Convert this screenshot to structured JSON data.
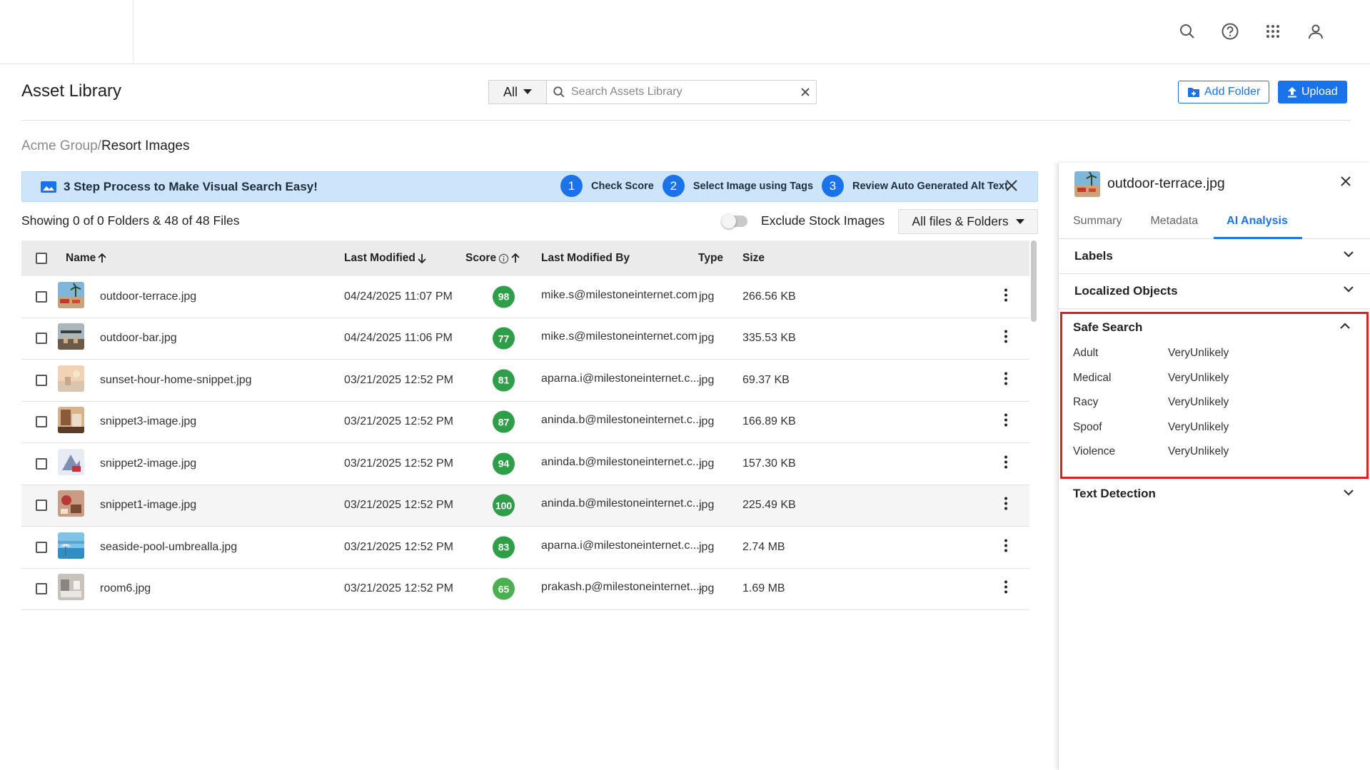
{
  "header": {
    "page_title": "Asset Library",
    "search_scope": "All",
    "search_placeholder": "Search Assets Library",
    "add_folder_label": "Add Folder",
    "upload_label": "Upload"
  },
  "breadcrumb": {
    "parent": "Acme Group/",
    "current": "Resort Images"
  },
  "banner": {
    "title": "3 Step Process to Make Visual Search Easy!",
    "steps": [
      {
        "num": "1",
        "label": "Check Score"
      },
      {
        "num": "2",
        "label": "Select Image using Tags"
      },
      {
        "num": "3",
        "label": "Review Auto Generated Alt Text"
      }
    ]
  },
  "listing": {
    "showing_text": "Showing 0 of 0 Folders & 48 of 48 Files",
    "exclude_label": "Exclude Stock Images",
    "filter_value": "All files & Folders"
  },
  "table": {
    "columns": {
      "name": "Name",
      "modified": "Last Modified",
      "score": "Score",
      "modified_by": "Last Modified By",
      "type": "Type",
      "size": "Size"
    },
    "rows": [
      {
        "name": "outdoor-terrace.jpg",
        "modified": "04/24/2025 11:07 PM",
        "score": "98",
        "by": "mike.s@milestoneinternet.com",
        "type": "jpg",
        "size": "266.56 KB"
      },
      {
        "name": "outdoor-bar.jpg",
        "modified": "04/24/2025 11:06 PM",
        "score": "77",
        "by": "mike.s@milestoneinternet.com",
        "type": "jpg",
        "size": "335.53 KB"
      },
      {
        "name": "sunset-hour-home-snippet.jpg",
        "modified": "03/21/2025 12:52 PM",
        "score": "81",
        "by": "aparna.i@milestoneinternet.c...",
        "type": "jpg",
        "size": "69.37 KB"
      },
      {
        "name": "snippet3-image.jpg",
        "modified": "03/21/2025 12:52 PM",
        "score": "87",
        "by": "aninda.b@milestoneinternet.c...",
        "type": "jpg",
        "size": "166.89 KB"
      },
      {
        "name": "snippet2-image.jpg",
        "modified": "03/21/2025 12:52 PM",
        "score": "94",
        "by": "aninda.b@milestoneinternet.c...",
        "type": "jpg",
        "size": "157.30 KB"
      },
      {
        "name": "snippet1-image.jpg",
        "modified": "03/21/2025 12:52 PM",
        "score": "100",
        "by": "aninda.b@milestoneinternet.c...",
        "type": "jpg",
        "size": "225.49 KB"
      },
      {
        "name": "seaside-pool-umbrealla.jpg",
        "modified": "03/21/2025 12:52 PM",
        "score": "83",
        "by": "aparna.i@milestoneinternet.c...",
        "type": "jpg",
        "size": "2.74 MB"
      },
      {
        "name": "room6.jpg",
        "modified": "03/21/2025 12:52 PM",
        "score": "65",
        "by": "prakash.p@milestoneinternet....",
        "type": "jpg",
        "size": "1.69 MB"
      }
    ]
  },
  "panel": {
    "file_name": "outdoor-terrace.jpg",
    "tabs": [
      "Summary",
      "Metadata",
      "AI Analysis"
    ],
    "sections": {
      "labels": "Labels",
      "localized": "Localized Objects",
      "safe_search": "Safe Search",
      "text_detection": "Text Detection"
    },
    "safe_search": [
      {
        "k": "Adult",
        "v": "VeryUnlikely"
      },
      {
        "k": "Medical",
        "v": "VeryUnlikely"
      },
      {
        "k": "Racy",
        "v": "VeryUnlikely"
      },
      {
        "k": "Spoof",
        "v": "VeryUnlikely"
      },
      {
        "k": "Violence",
        "v": "VeryUnlikely"
      }
    ]
  },
  "colors": {
    "accent": "#1a73e8",
    "score_green": "#2e9e49",
    "highlight_red": "#e02020",
    "banner_bg": "#cde5fb"
  },
  "icons": [
    "search-icon",
    "help-icon",
    "apps-grid-icon",
    "user-icon",
    "close-icon",
    "caret-down-icon",
    "image-icon",
    "folder-add-icon",
    "upload-icon",
    "info-icon",
    "kebab-icon",
    "chevron-down-icon",
    "chevron-up-icon"
  ]
}
